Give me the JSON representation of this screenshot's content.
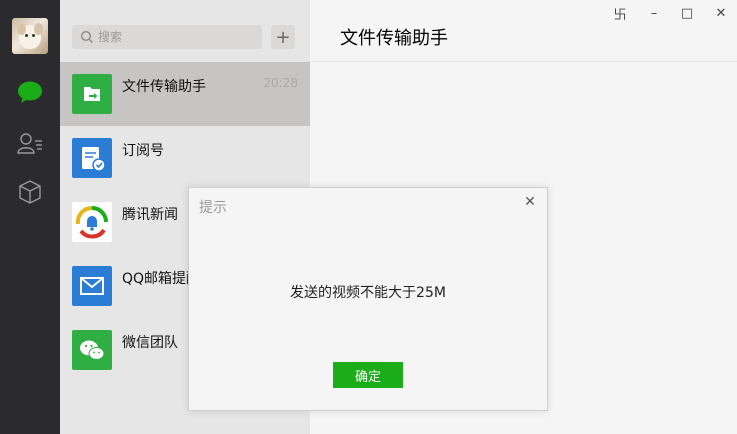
{
  "search": {
    "placeholder": "搜索",
    "value": "",
    "add_label": "+"
  },
  "rail": {
    "icons": [
      "avatar",
      "chat-icon",
      "contacts-icon",
      "box-icon"
    ],
    "active_color": "#1aad19"
  },
  "chats": [
    {
      "name": "文件传输助手",
      "time": "20:28",
      "icon": "file-transfer-icon",
      "color": "#2fae44",
      "selected": true
    },
    {
      "name": "订阅号",
      "time": "",
      "icon": "subscription-icon",
      "color": "#2a7cd4",
      "selected": false
    },
    {
      "name": "腾讯新闻",
      "time": "",
      "icon": "tencent-news-icon",
      "color": "#ffffff",
      "selected": false
    },
    {
      "name": "QQ邮箱提醒",
      "time": "",
      "icon": "mail-icon",
      "color": "#2a7cd4",
      "selected": false
    },
    {
      "name": "微信团队",
      "time": "",
      "icon": "wechat-team-icon",
      "color": "#2fae44",
      "selected": false
    }
  ],
  "main": {
    "title": "文件传输助手"
  },
  "window_controls": {
    "pin": "卐",
    "minimize": "–",
    "maximize": "□",
    "close": "✕"
  },
  "dialog": {
    "title": "提示",
    "message": "发送的视频不能大于25M",
    "ok_label": "确定",
    "close_label": "✕",
    "ok_color": "#1aad19"
  }
}
